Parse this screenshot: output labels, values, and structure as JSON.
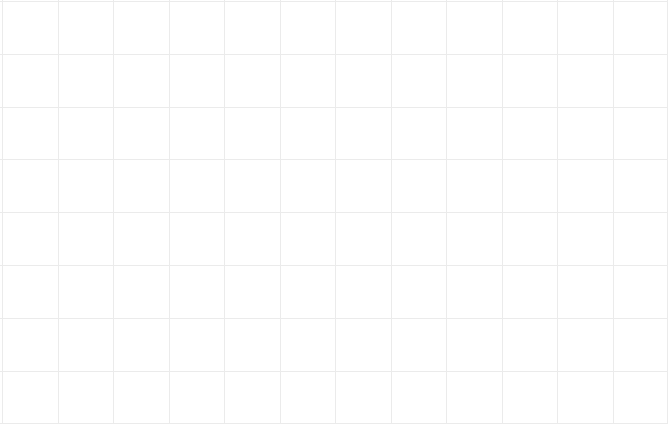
{
  "grid": {
    "columns": 12,
    "rows": 8,
    "line_color": "#ebebeb",
    "background_color": "#ffffff"
  }
}
